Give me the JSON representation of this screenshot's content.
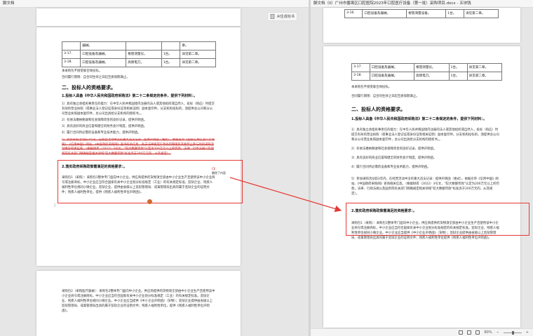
{
  "left": {
    "title": "脚文档",
    "ai_button": "AI生成标书",
    "table_rows": [
      {
        "no": "",
        "item": "器械。",
        "desc": "",
        "qty": "",
        "note": "章。"
      },
      {
        "no": "3-17.",
        "item": "口腔设备及器械。",
        "desc": "根管测量仪。",
        "qty": "1台。",
        "note": "详见第二章。"
      },
      {
        "no": "3-18.",
        "item": "口腔设备及器械。",
        "desc": "高频电刀。",
        "qty": "1台。",
        "note": "详见第二章。"
      }
    ],
    "notes": [
      "本采购包不接受联合体投标。",
      "合同履行期限：自合同生效之日起至质保期满止。"
    ],
    "heading": "二、投标人的资格要求。",
    "sub1": "1.投标人具备《中华人民共和国政府采购法》第二十二条规定的条件，提供下列材料：。",
    "para1": "1）具有独立承担民事责任的能力：在中华人民共和国境内注册的法人或其他组织或自然人，投标（响应）时提交有效的营业执照（或事业法人登记证或身份证等相关证明）副本复印件。分支机构投标的，须提供总公司和分公司营业执照副本复印件，总公司出具给分支机构的授权书。。",
    "para2": "2）有依法缴纳税收和社会保障资金的良好记录，提供声明函。",
    "para3": "3）具有良好的商业信誉和健全的财务会计制度，提供声明函。",
    "para4": "4）履行合同所必需的设备和专业技术能力，提供声明函。",
    "strike_text": "5）参加采购活动前3年内，在经营活动中没有重大违法记录：提供声明函（格式）。依据名单《国家信用信息公示系统》、《信用中国》网站、《中国政府采购网》查询有关信息，处于法律规定行政处罚期限及其他禁止参与政府采购活动情形的供应商。（根据财库（2022）3号文，\"较大数额罚款\"认定为200万元以上的罚款，法律、行政法规以及国务院有关部门明确规定相关领域\"较大数额罚款\"标准高于200万元的，从其规定）。",
    "comment_label": "CE",
    "comment_text": "删除了内容",
    "heading2": "2.落实政府采购政策需满足的资格要求：。",
    "para5": "采购包1（采购）：采购包1整体专门面向中小企业。供应商提供的货物须全部由中小企业生产且使用该中小企业商号或注册商标，中小企业应当符合国家有关中小企业划分标准规定（工业）的有关规定标准。监狱企业、残疾人福利性单位视同小微企业。监狱企业，提供由省级以上监狱管理局、戒毒管理局出具的属于监狱企业的证明文件；残疾人福利性单位，提供《残疾人福利性单位声明函》。",
    "para6": "采购包2（采购医疗器械）：采购包2整体专门面向中小企业。供应商提供的货物须全部由中小企业生产且使用该中小企业商号或注册商标，中小企业应当符合国家有关中小企业划分标准规定（工业）的有关规定标准。监狱企业、残疾人福利性单位视同小微企业。中小企业应当提供《中小企业声明函》（货物）；监狱企业提供由省级以上监狱管理局、戒毒管理局出具的属于监狱企业的证明文件；残疾人福利性单位，提供《残疾人福利性单位声明函》。"
  },
  "right": {
    "title": "脚文档（II）广州市番禺区口腔医院2023年口腔医疗设备（第一批）采购项目.docx - 五块钱",
    "top_rows": [
      {
        "no": "3-16.",
        "item": "口腔设备及器械。",
        "desc": "根管测量设备。",
        "qty": "1台。",
        "note": "详见第二章。"
      }
    ],
    "table_rows": [
      {
        "no": "3-17.",
        "item": "口腔设备及器械。",
        "desc": "根管测量仪。",
        "qty": "1台。",
        "note": "详见第二章。"
      },
      {
        "no": "3-18.",
        "item": "口腔设备及器械。",
        "desc": "高频电刀。",
        "qty": "1台。",
        "note": "详见第二章。"
      }
    ],
    "notes": [
      "本采购包不接受联合体投标。",
      "合同履行期限：自合同生效之日起至质保期满止。"
    ],
    "heading": "二、投标人的资格要求。",
    "sub1": "1.投标人具备《中华人民共和国政府采购法》第二十二条规定的条件，提供下列材料：。",
    "para1": "1）具有独立承担民事责任的能力：在中华人民共和国境内注册的法人或其他组织或自然人，投标（响应）时提交有效的营业执照（或事业法人登记证或身份证等相关证明）副本复印件。分支机构投标的，须提供总公司和分公司营业执照副本复印件，总公司出具给分支机构的授权书。。",
    "para2": "2）有依法缴纳税收和社会保障资金的良好记录，提供声明函。",
    "para3": "3）具有良好的商业信誉和健全的财务会计制度，提供声明函。",
    "para4": "4）履行合同所必需的设备和专业技术能力，提供声明函。",
    "boxed": "5）参加采购活动前3年内，在经营活动中没有重大违法记录：提供声明函（格式）。依据名单《信用中国》网站、《中国政府采购网》查询相关信息。（根据财库（2022）3号文，\"较大数额罚款\"认定为200万元以上的罚款，法律、行政法规以及国务院有关部门明确规定相关领域\"较大数额罚款\"标准高于200万元的，从其规定）。",
    "heading2": "2.落实政府采购政策需满足的资格要求：。",
    "para5": "采购包1（采购）：采购包1整体专门面向中小企业。供应商提供的货物须全部由中小企业生产且使用该中小企业商号或注册商标，中小企业应当符合国家有关中小企业划分标准规定的有关规定标准。监狱企业、残疾人福利性单位视同小微企业。中小企业应当提供《中小企业声明函》（货物）；监狱企业提供由省级以上监狱管理局、戒毒管理局出具的属于监狱企业的证明文件；残疾人福利性单位提供《残疾人福利性单位声明函》。",
    "zoom": "80%"
  }
}
